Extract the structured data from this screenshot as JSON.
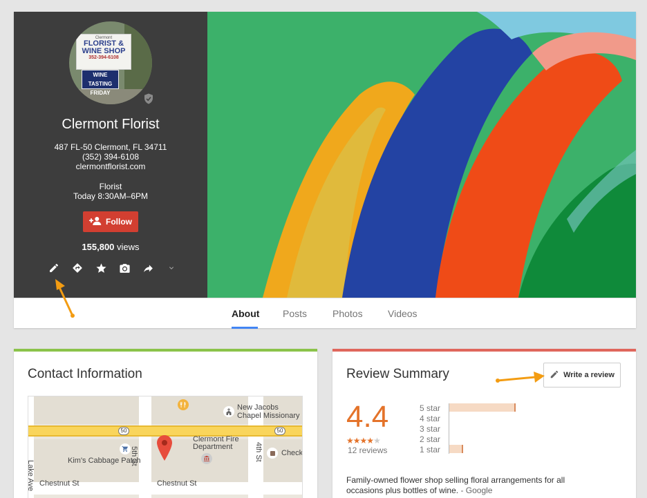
{
  "profile": {
    "name": "Clermont Florist",
    "address": "487 FL-50 Clermont, FL 34711",
    "phone": "(352) 394-6108",
    "website": "clermontflorist.com",
    "category": "Florist",
    "hours": "Today 8:30AM–6PM",
    "follow_label": "Follow",
    "views_count": "155,800",
    "views_label": "views",
    "avatar_sign": {
      "top": "Clermont",
      "line1": "FLORIST &",
      "line2": "WINE SHOP",
      "phone": "352-394-6108",
      "wine1": "WINE TASTING",
      "wine2": "FRIDAY"
    }
  },
  "tabs": [
    "About",
    "Posts",
    "Photos",
    "Videos"
  ],
  "contact": {
    "title": "Contact Information",
    "map": {
      "labels": [
        "New Jacobs",
        "Chapel Missionary",
        "Clermont Fire",
        "Department",
        "Kim's Cabbage Patch",
        "Check",
        "Chestnut St",
        "Chestnut St",
        "5th St",
        "4th St",
        "Lake Ave"
      ],
      "route": "50"
    }
  },
  "review": {
    "title": "Review Summary",
    "write_label": "Write a review",
    "rating": "4.4",
    "rating_value": 4.4,
    "review_count": "12 reviews",
    "star_labels": [
      "5 star",
      "4 star",
      "3 star",
      "2 star",
      "1 star"
    ],
    "distribution": [
      0.83,
      0.0,
      0.0,
      0.0,
      0.17
    ],
    "description": "Family-owned flower shop selling floral arrangements for all occasions plus bottles of wine.",
    "source": "- Google"
  },
  "colors": {
    "accent_red": "#d23f31",
    "rating_orange": "#e4732a",
    "arrow_orange": "#f39c12",
    "tab_blue": "#4285f4"
  }
}
